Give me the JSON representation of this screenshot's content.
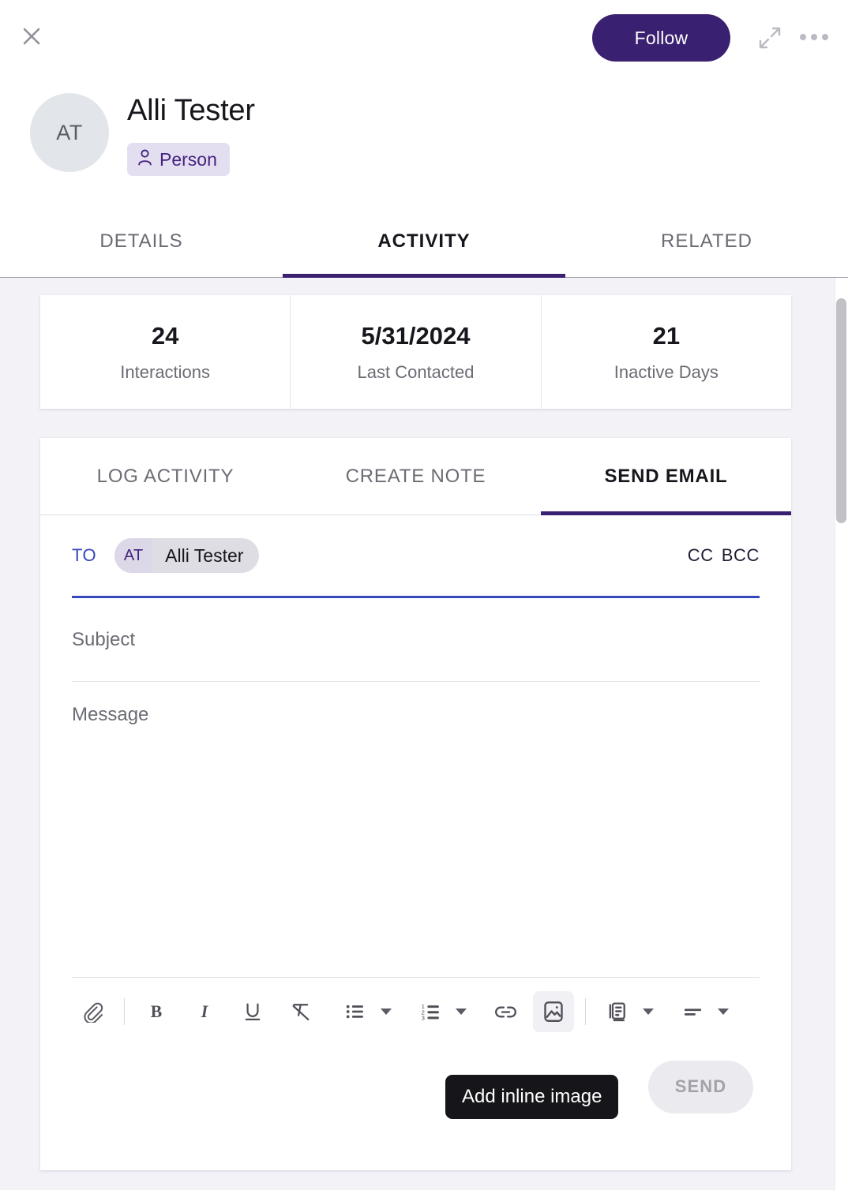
{
  "header": {
    "close_icon": "close-icon",
    "follow_label": "Follow",
    "expand_icon": "expand-arrows-icon",
    "more_icon": "more-horizontal-icon",
    "avatar_initials": "AT",
    "record_name": "Alli Tester",
    "type_badge": {
      "icon": "person-icon",
      "label": "Person"
    },
    "accent_color": "#3A2070"
  },
  "main_tabs": [
    {
      "label": "DETAILS",
      "active": false
    },
    {
      "label": "ACTIVITY",
      "active": true
    },
    {
      "label": "RELATED",
      "active": false
    }
  ],
  "stats": [
    {
      "value": "24",
      "label": "Interactions"
    },
    {
      "value": "5/31/2024",
      "label": "Last Contacted"
    },
    {
      "value": "21",
      "label": "Inactive Days"
    }
  ],
  "composer": {
    "tabs": [
      {
        "label": "LOG ACTIVITY",
        "active": false
      },
      {
        "label": "CREATE NOTE",
        "active": false
      },
      {
        "label": "SEND EMAIL",
        "active": true
      }
    ],
    "to": {
      "label": "TO",
      "chip": {
        "initials": "AT",
        "name": "Alli Tester"
      },
      "cc_label": "CC",
      "bcc_label": "BCC",
      "underline_color": "#3646BB"
    },
    "subject": {
      "placeholder": "Subject",
      "value": ""
    },
    "message": {
      "placeholder": "Message",
      "value": ""
    },
    "toolbar": [
      {
        "name": "attach-icon",
        "label": "Attach file"
      },
      {
        "name": "bold-icon",
        "label": "Bold"
      },
      {
        "name": "italic-icon",
        "label": "Italic"
      },
      {
        "name": "underline-icon",
        "label": "Underline"
      },
      {
        "name": "clear-formatting-icon",
        "label": "Remove formatting"
      },
      {
        "name": "bulleted-list-icon",
        "label": "Bulleted list"
      },
      {
        "name": "numbered-list-icon",
        "label": "Numbered list"
      },
      {
        "name": "link-icon",
        "label": "Insert link"
      },
      {
        "name": "inline-image-icon",
        "label": "Add inline image"
      },
      {
        "name": "template-icon",
        "label": "Insert template"
      },
      {
        "name": "align-icon",
        "label": "Text alignment"
      }
    ],
    "tooltip": "Add inline image",
    "send_label": "SEND"
  }
}
